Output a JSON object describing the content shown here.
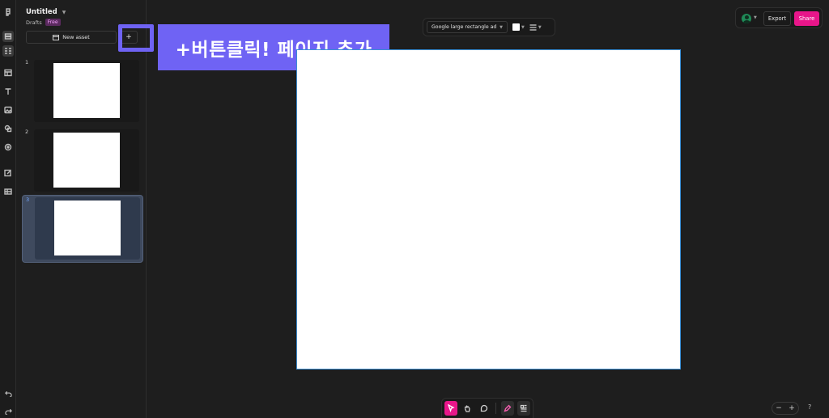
{
  "file": {
    "title": "Untitled",
    "location": "Drafts",
    "plan_badge": "Free"
  },
  "panel": {
    "new_asset_label": "New asset",
    "add_page_label": "+",
    "pages": [
      {
        "number": "1",
        "selected": false
      },
      {
        "number": "2",
        "selected": false
      },
      {
        "number": "3",
        "selected": true
      }
    ]
  },
  "callout": {
    "text": "+버튼클릭! 페이지 추가"
  },
  "top_toolbar": {
    "size_preset": "Google large rectangle ad",
    "fill_color": "#ffffff"
  },
  "top_right": {
    "export_label": "Export",
    "share_label": "Share"
  },
  "zoom": {
    "minus": "−",
    "plus": "+"
  },
  "help_label": "?",
  "colors": {
    "accent_pink": "#e8168a",
    "callout_purple": "#6f63f4",
    "selection_blue": "#3b8fd6"
  },
  "icons": {
    "rail": [
      "logo-icon",
      "layers-icon",
      "pages-icon",
      "template-icon",
      "text-icon",
      "image-icon",
      "shapes-icon",
      "record-icon",
      "edit-icon",
      "table-icon"
    ],
    "bottom_tools": [
      "select-icon",
      "hand-icon",
      "comment-icon",
      "pen-icon",
      "grid-icon"
    ]
  }
}
